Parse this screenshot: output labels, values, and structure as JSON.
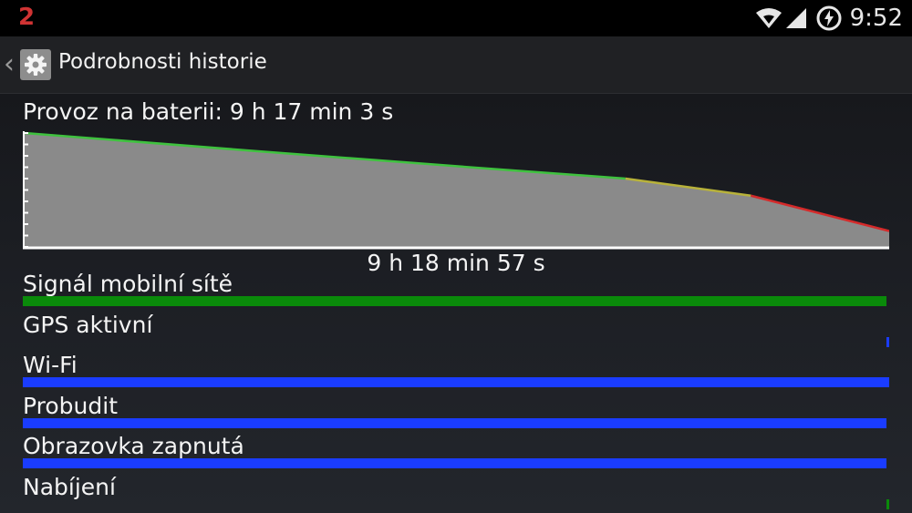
{
  "status_bar": {
    "notification_count": "2",
    "time": "9:52",
    "icons": [
      "wifi-icon",
      "signal-icon",
      "battery-charging-icon"
    ]
  },
  "action_bar": {
    "back_icon": "chevron-left-icon",
    "app_icon": "settings-gear-icon",
    "title": "Podrobnosti historie"
  },
  "battery": {
    "label": "Provoz na baterii: 9 h 17 min 3 s",
    "duration": "9 h 18 min 57 s"
  },
  "chart_data": {
    "type": "area",
    "x": [
      0,
      0.27,
      0.55,
      0.695,
      0.84,
      1.0
    ],
    "level_pct": [
      100,
      84,
      68,
      60,
      45,
      14
    ],
    "segment_colors": [
      {
        "from_x": 0,
        "to_x": 0.695,
        "color": "#3fc23f"
      },
      {
        "from_x": 0.695,
        "to_x": 0.84,
        "color": "#b8b23a"
      },
      {
        "from_x": 0.84,
        "to_x": 1.0,
        "color": "#d42a2a"
      }
    ],
    "fill_color": "#8a8a8a"
  },
  "rows": [
    {
      "label": "Signál mobilní sítě",
      "color": "#0a8a0a",
      "fill_from": 0.0,
      "fill_to": 0.997
    },
    {
      "label": "GPS aktivní",
      "color": "#1a3cff",
      "fill_from": 0.997,
      "fill_to": 1.0
    },
    {
      "label": "Wi-Fi",
      "color": "#1a3cff",
      "fill_from": 0.0,
      "fill_to": 1.0
    },
    {
      "label": "Probudit",
      "color": "#1a3cff",
      "fill_from": 0.0,
      "fill_to": 0.997
    },
    {
      "label": "Obrazovka zapnutá",
      "color": "#1a3cff",
      "fill_from": 0.0,
      "fill_to": 0.997
    },
    {
      "label": "Nabíjení",
      "color": "#0a8a0a",
      "fill_from": 0.997,
      "fill_to": 1.0
    }
  ]
}
